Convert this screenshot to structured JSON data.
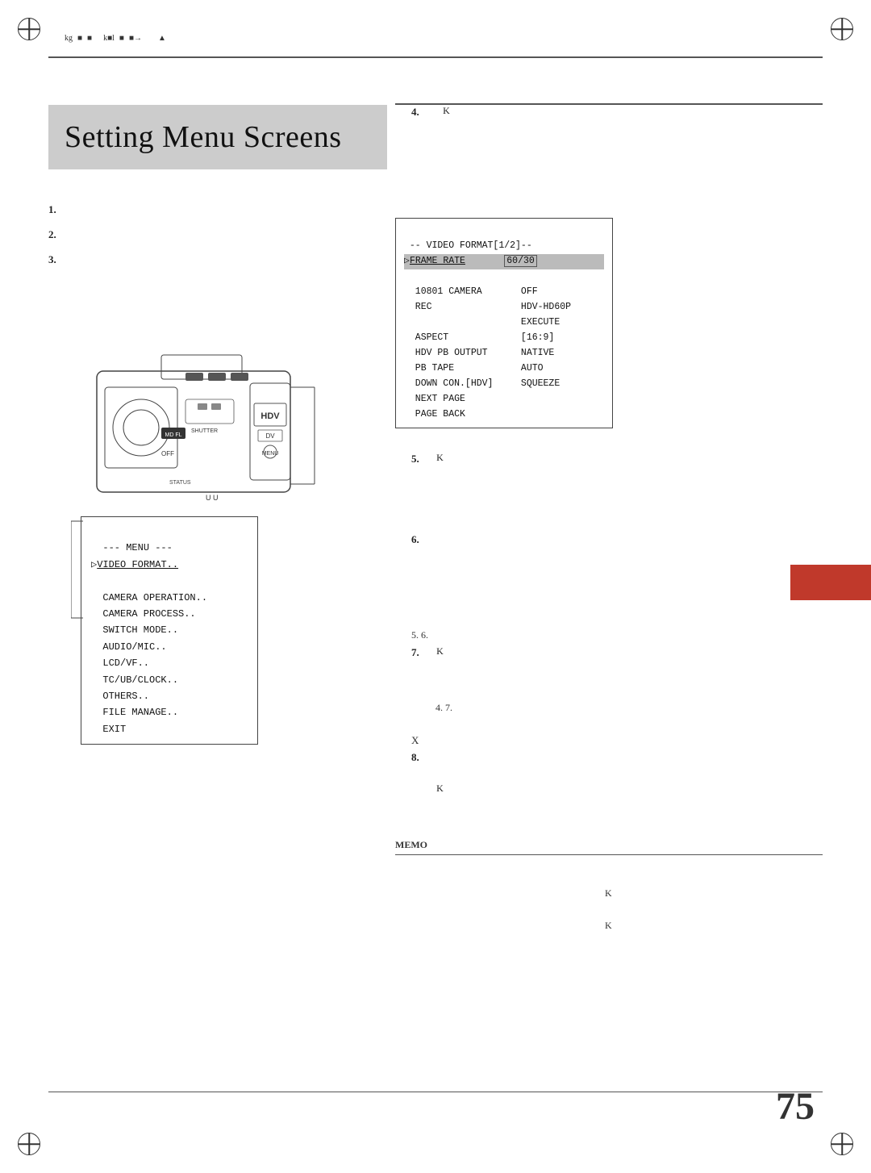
{
  "page": {
    "number": "75",
    "title": "Setting Menu Screens"
  },
  "topNav": {
    "items": [
      "kg",
      "■",
      "■",
      "k■l",
      "■",
      "■→",
      "▲"
    ]
  },
  "leftColumn": {
    "numberedItems": [
      {
        "num": "1.",
        "text": ""
      },
      {
        "num": "2.",
        "text": ""
      },
      {
        "num": "3.",
        "text": ""
      }
    ]
  },
  "menuBox": {
    "title": "--- MENU ---",
    "cursor": "▷",
    "items": [
      "VIDEO FORMAT..",
      "CAMERA OPERATION..",
      "CAMERA PROCESS..",
      "SWITCH MODE..",
      "AUDIO/MIC..",
      "LCD/VF..",
      "TC/UB/CLOCK..",
      "OTHERS..",
      "FILE MANAGE..",
      "EXIT"
    ],
    "selectedItem": "VIDEO FORMAT.."
  },
  "videoFormatBox": {
    "header": "-- VIDEO FORMAT[1/2]--",
    "cursor": "▷",
    "rows": [
      {
        "label": "FRAME RATE",
        "value": "60/30",
        "selected": true
      },
      {
        "label": "10801 CAMERA",
        "value": "OFF"
      },
      {
        "label": "REC",
        "value": "HDV-HD60P"
      },
      {
        "label": "",
        "value": "EXECUTE"
      },
      {
        "label": "ASPECT",
        "value": "[16:9]"
      },
      {
        "label": "HDV PB OUTPUT",
        "value": "NATIVE"
      },
      {
        "label": "PB TAPE",
        "value": "AUTO"
      },
      {
        "label": "DOWN CON.[HDV]",
        "value": "SQUEEZE"
      },
      {
        "label": "NEXT PAGE",
        "value": ""
      },
      {
        "label": "PAGE BACK",
        "value": ""
      }
    ]
  },
  "rightItems": [
    {
      "num": "4.",
      "text": "K"
    },
    {
      "num": "5.",
      "text": "K"
    },
    {
      "num": "6.",
      "text": ""
    },
    {
      "num": "7.",
      "text": "K"
    },
    {
      "num": "8.",
      "text": "K"
    }
  ],
  "inlineRefs": {
    "ref57": "5.  6.",
    "ref47": "4.  7.",
    "xLabel": "X"
  },
  "memo": {
    "label": "MEMO"
  },
  "kLabels": [
    "K",
    "K"
  ]
}
